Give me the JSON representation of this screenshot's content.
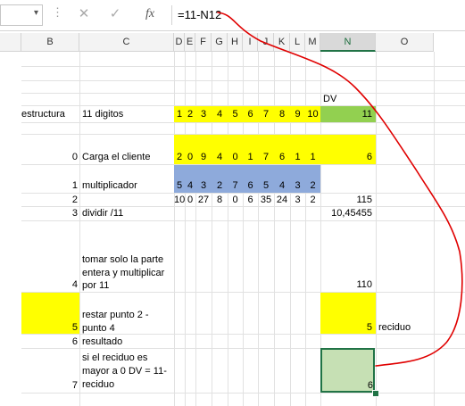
{
  "formula_bar": {
    "name_box": "",
    "cancel_icon": "✕",
    "enter_icon": "✓",
    "fx_label": "fx",
    "formula": "=11-N12"
  },
  "columns": [
    "B",
    "C",
    "D",
    "E",
    "F",
    "G",
    "H",
    "I",
    "J",
    "K",
    "L",
    "M",
    "N",
    "O"
  ],
  "sheet": {
    "dv_header": "DV",
    "row_estructura": {
      "b": "estructura",
      "c": "11 digitos",
      "digits": [
        "1",
        "2",
        "3",
        "4",
        "5",
        "6",
        "7",
        "8",
        "9",
        "10"
      ],
      "n": "11"
    },
    "row_cliente": {
      "b": "0",
      "c": "Carga el cliente",
      "digits": [
        "2",
        "0",
        "9",
        "4",
        "0",
        "1",
        "7",
        "6",
        "1",
        "1"
      ],
      "n": "6"
    },
    "row_mult": {
      "b": "1",
      "c": "multiplicador",
      "digits": [
        "5",
        "4",
        "3",
        "2",
        "7",
        "6",
        "5",
        "4",
        "3",
        "2"
      ]
    },
    "row_prod": {
      "b": "2",
      "digits": [
        "10",
        "0",
        "27",
        "8",
        "0",
        "6",
        "35",
        "24",
        "3",
        "2"
      ],
      "n": "115"
    },
    "row_div": {
      "b": "3",
      "c": "dividir /11",
      "n": "10,45455"
    },
    "row_entera": {
      "b": "4",
      "c": "tomar solo la parte entera y multiplicar por 11",
      "n": "110"
    },
    "row_resta": {
      "b": "5",
      "c": "restar punto 2 - punto 4",
      "n": "5",
      "o": "reciduo"
    },
    "row_result": {
      "b": "6",
      "c": "resultado"
    },
    "row_final": {
      "b": "7",
      "c": "si el reciduo es mayor a 0 DV = 11- reciduo",
      "n": "6"
    }
  },
  "colors": {
    "yellow": "#ffff00",
    "green": "#92d050",
    "blue": "#8eaadb",
    "annotation": "#e00000",
    "selection": "#217346"
  }
}
